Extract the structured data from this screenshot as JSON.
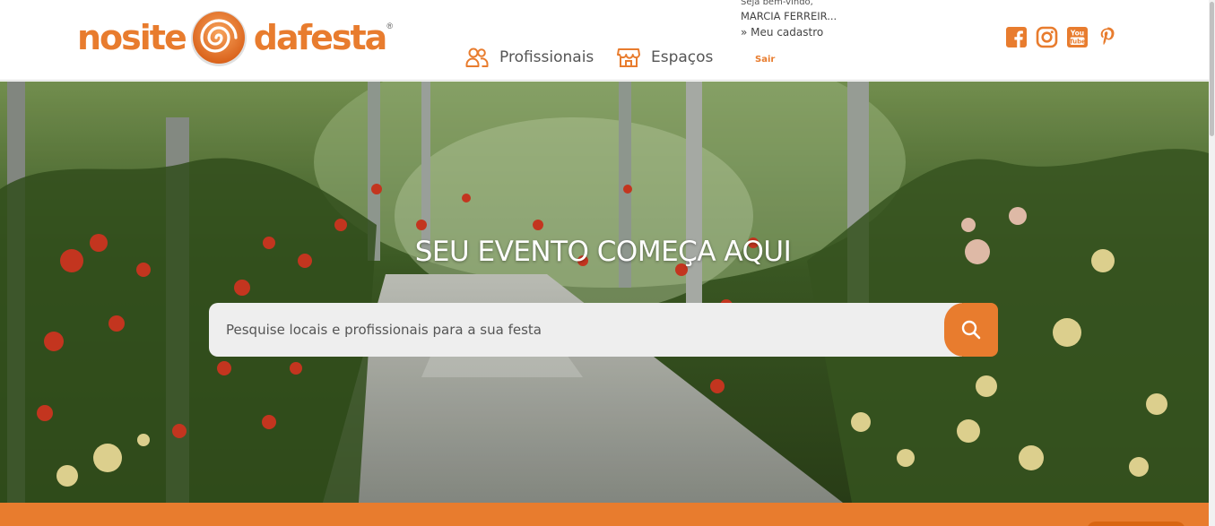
{
  "brand": {
    "logo_part1": "nosite",
    "logo_part2": "dafesta",
    "logo_reg": "®",
    "accent": "#e87c2e"
  },
  "nav": {
    "items": [
      {
        "label": "Profissionais",
        "icon": "people-icon"
      },
      {
        "label": "Espaços",
        "icon": "storefront-icon"
      }
    ]
  },
  "user": {
    "welcome": "Seja bem-vindo,",
    "name": "MARCIA FERREIR...",
    "profile_link": "» Meu cadastro",
    "logout": "Sair"
  },
  "socials": [
    {
      "icon": "facebook-icon"
    },
    {
      "icon": "instagram-icon"
    },
    {
      "icon": "youtube-icon"
    },
    {
      "icon": "pinterest-icon"
    }
  ],
  "hero": {
    "title": "SEU EVENTO COMEÇA AQUI",
    "search_placeholder": "Pesquise locais e profissionais para a sua festa",
    "search_button_icon": "search-icon"
  }
}
